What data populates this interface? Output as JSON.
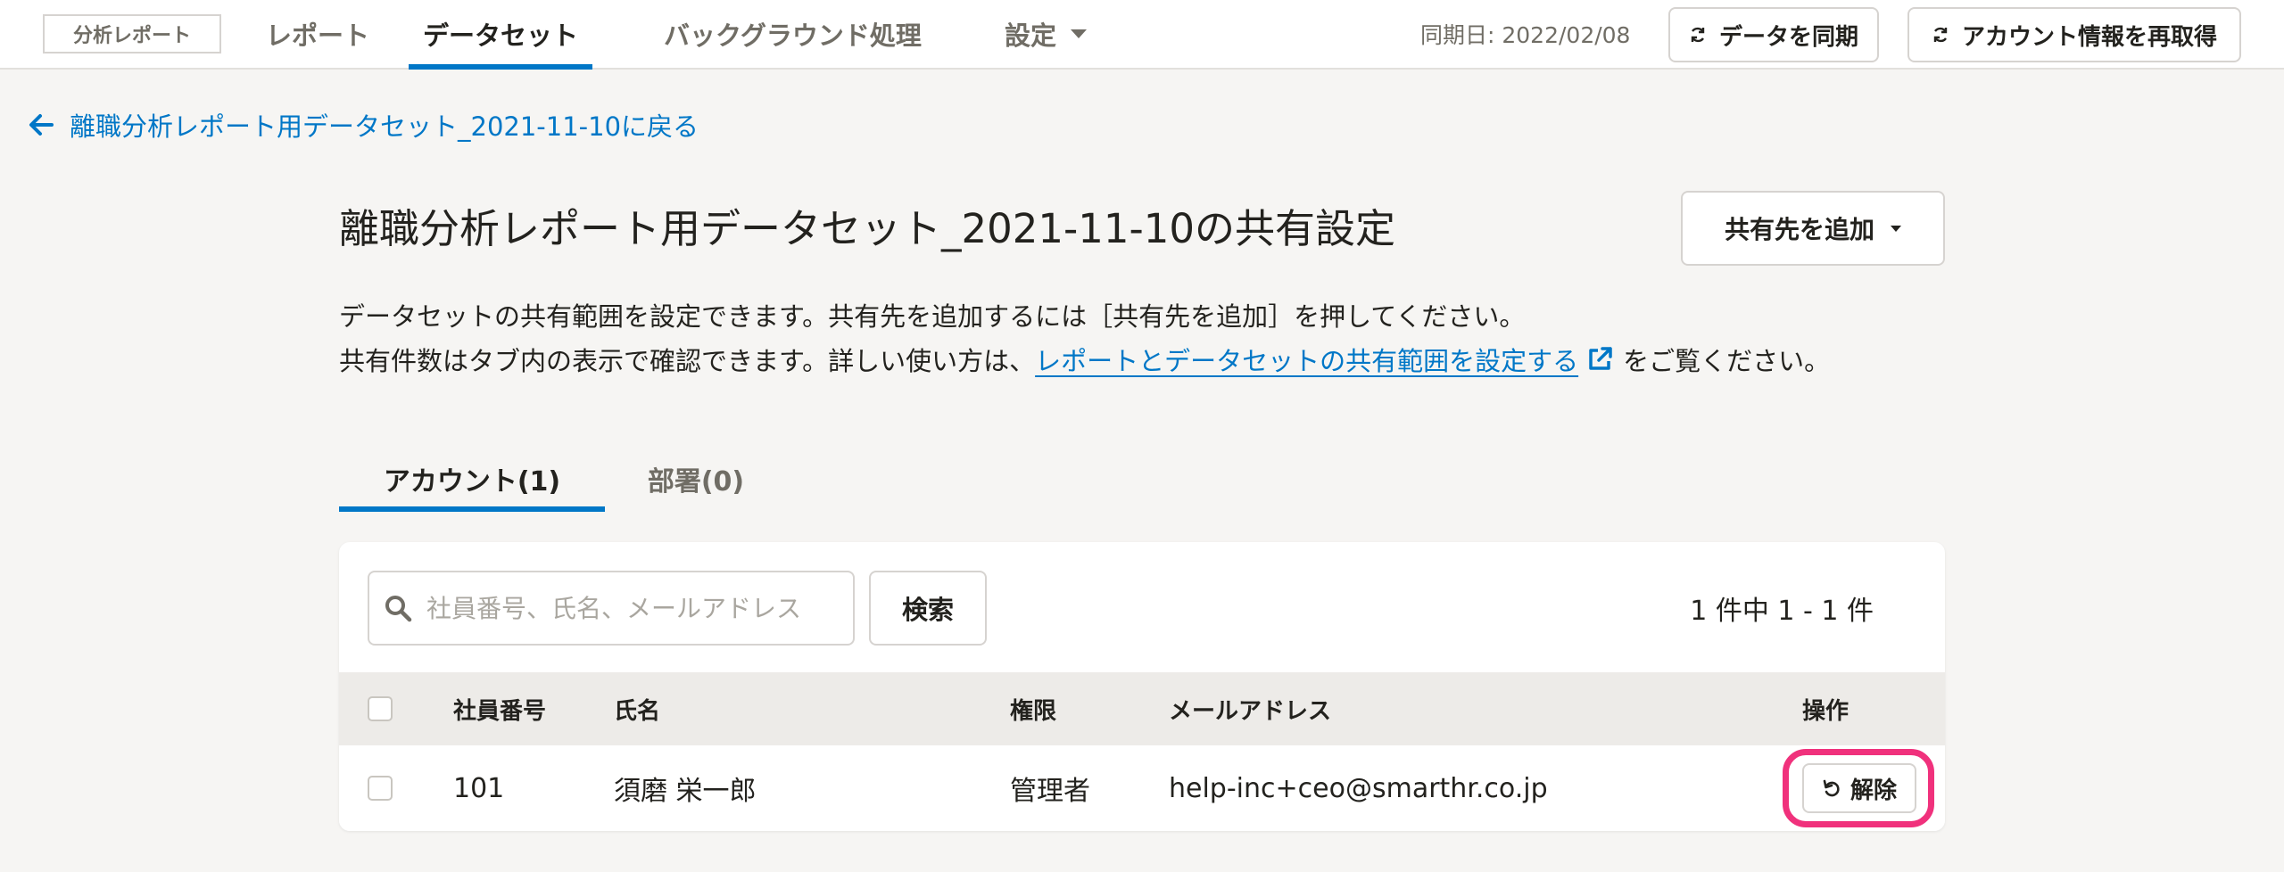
{
  "nav": {
    "brand": "分析レポート",
    "items": [
      {
        "label": "レポート"
      },
      {
        "label": "データセット"
      },
      {
        "label": "バックグラウンド処理"
      },
      {
        "label": "設定"
      }
    ],
    "active_item": "データセット",
    "sync_date": "同期日: 2022/02/08",
    "sync_button": "データを同期",
    "refetch_button": "アカウント情報を再取得"
  },
  "back_link": "離職分析レポート用データセット_2021-11-10に戻る",
  "page": {
    "title": "離職分析レポート用データセット_2021-11-10の共有設定",
    "add_share_button": "共有先を追加",
    "description_line1": "データセットの共有範囲を設定できます。共有先を追加するには［共有先を追加］を押してください。",
    "description_line2_prefix": "共有件数はタブ内の表示で確認できます。詳しい使い方は、",
    "description_link": "レポートとデータセットの共有範囲を設定する",
    "description_line2_suffix": "をご覧ください。"
  },
  "tabs": [
    {
      "label": "アカウント(1)",
      "active": true
    },
    {
      "label": "部署(0)",
      "active": false
    }
  ],
  "search": {
    "placeholder": "社員番号、氏名、メールアドレス",
    "button": "検索",
    "value": ""
  },
  "result_count": "1 件中 1 - 1 件",
  "table": {
    "columns": [
      "社員番号",
      "氏名",
      "権限",
      "メールアドレス",
      "操作"
    ],
    "rows": [
      {
        "employee_no": "101",
        "name": "須磨 栄一郎",
        "role": "管理者",
        "email": "help-inc+ceo@smarthr.co.jp",
        "action": "解除"
      }
    ]
  },
  "colors": {
    "accent": "#0077c7",
    "highlight": "#f0317c",
    "background": "#f6f5f3"
  },
  "icons": {
    "sync": "refresh-icon",
    "back": "arrow-left-icon",
    "external": "external-link-icon",
    "search": "search-icon",
    "release": "undo-icon",
    "dropdown": "caret-down-icon"
  }
}
